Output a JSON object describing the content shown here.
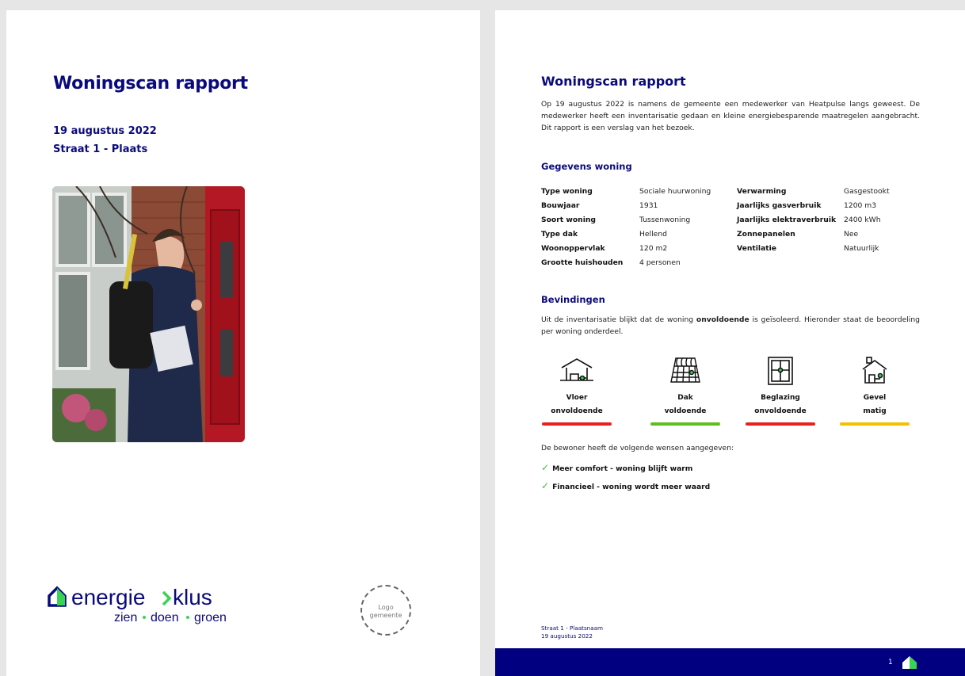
{
  "cover": {
    "title": "Woningscan rapport",
    "date": "19 augustus 2022",
    "address": "Straat 1 - Plaats",
    "brand": {
      "word1": "energie",
      "word2": "klus",
      "tagline": [
        "zien",
        "doen",
        "groen"
      ]
    },
    "city_logo": [
      "Logo",
      "gemeente"
    ]
  },
  "report": {
    "title": "Woningscan rapport",
    "intro": "Op 19 augustus 2022 is namens de gemeente een medewerker van Heatpulse langs geweest. De medewerker heeft een inventarisatie gedaan en kleine energiebesparende maatregelen aangebracht. Dit rapport is een verslag van het bezoek.",
    "gegevens_title": "Gegevens woning",
    "gegevens": [
      {
        "k1": "Type woning",
        "v1": "Sociale huurwoning",
        "k2": "Verwarming",
        "v2": "Gasgestookt"
      },
      {
        "k1": "Bouwjaar",
        "v1": "1931",
        "k2": "Jaarlijks gasverbruik",
        "v2": "1200 m3"
      },
      {
        "k1": "Soort woning",
        "v1": "Tussenwoning",
        "k2": "Jaarlijks elektraverbruik",
        "v2": "2400 kWh"
      },
      {
        "k1": "Type dak",
        "v1": "Hellend",
        "k2": "Zonnepanelen",
        "v2": "Nee"
      },
      {
        "k1": "Woonoppervlak",
        "v1": "120 m2",
        "k2": "Ventilatie",
        "v2": "Natuurlijk"
      },
      {
        "k1": "Grootte huishouden",
        "v1": "4 personen",
        "k2": "",
        "v2": ""
      }
    ],
    "bevindingen_title": "Bevindingen",
    "find_pre": "Uit de inventarisatie blijkt dat de woning ",
    "find_bold": "onvoldoende",
    "find_post": " is geïsoleerd. Hieronder staat de beoordeling per woning onderdeel.",
    "ratings": [
      {
        "name": "Vloer",
        "rating": "onvoldoende",
        "icon": "floor-icon",
        "color": "#e8211d"
      },
      {
        "name": "Dak",
        "rating": "voldoende",
        "icon": "roof-icon",
        "color": "#5fbf1a"
      },
      {
        "name": "Beglazing",
        "rating": "onvoldoende",
        "icon": "window-icon",
        "color": "#e8211d"
      },
      {
        "name": "Gevel",
        "rating": "matig",
        "icon": "facade-icon",
        "color": "#f5c000"
      }
    ],
    "wishes_intro": "De bewoner heeft de volgende wensen aangegeven:",
    "wishes": [
      "Meer comfort - woning blijft warm",
      "Financieel - woning wordt meer waard"
    ],
    "footer": {
      "line1": "Straat 1 - Plaatsnaam",
      "line2": "19 augustus 2022",
      "page": "1"
    }
  }
}
